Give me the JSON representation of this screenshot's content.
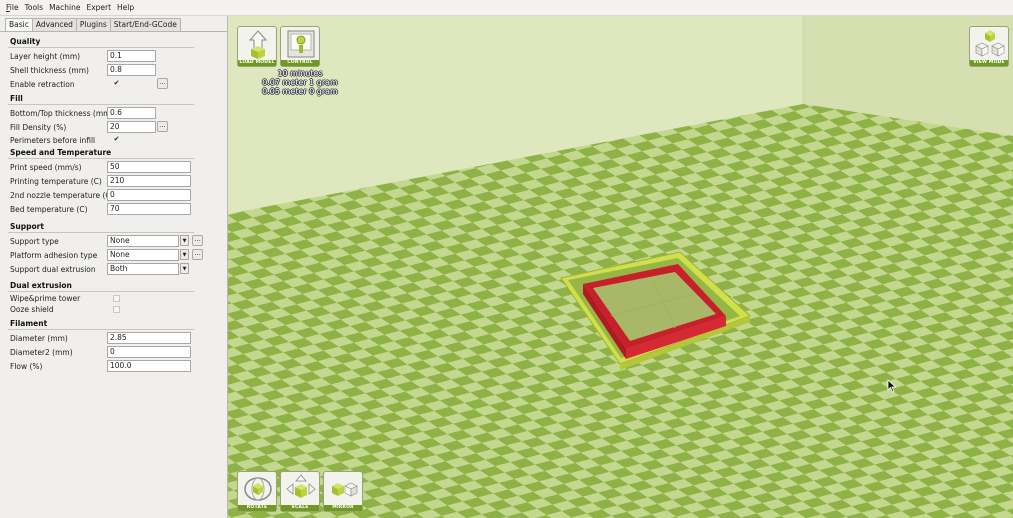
{
  "menu": {
    "items": [
      {
        "underlined": "F",
        "rest": "ile"
      },
      {
        "underlined": "",
        "rest": "Tools"
      },
      {
        "underlined": "",
        "rest": "Machine"
      },
      {
        "underlined": "",
        "rest": "Expert"
      },
      {
        "underlined": "",
        "rest": "Help"
      }
    ]
  },
  "tabs": [
    "Basic",
    "Advanced",
    "Plugins",
    "Start/End-GCode"
  ],
  "sections": {
    "quality": "Quality",
    "fill": "Fill",
    "speed": "Speed and Temperature",
    "support": "Support",
    "dual": "Dual extrusion",
    "filament": "Filament"
  },
  "settings": {
    "layer_height": {
      "label": "Layer height (mm)",
      "value": "0.1"
    },
    "shell_thickness": {
      "label": "Shell thickness (mm)",
      "value": "0.8"
    },
    "enable_retraction": {
      "label": "Enable retraction",
      "checked": "✔"
    },
    "bottom_top_thickness": {
      "label": "Bottom/Top thickness (mm)",
      "value": "0.6"
    },
    "fill_density": {
      "label": "Fill Density (%)",
      "value": "20"
    },
    "perimeters_before_infill": {
      "label": "Perimeters before infill",
      "checked": "✔"
    },
    "print_speed": {
      "label": "Print speed (mm/s)",
      "value": "50"
    },
    "printing_temperature": {
      "label": "Printing temperature (C)",
      "value": "210"
    },
    "nozzle2_temperature": {
      "label": "2nd nozzle temperature (C)",
      "value": "0"
    },
    "bed_temperature": {
      "label": "Bed temperature (C)",
      "value": "70"
    },
    "support_type": {
      "label": "Support type",
      "value": "None"
    },
    "platform_adhesion": {
      "label": "Platform adhesion type",
      "value": "None"
    },
    "support_dual": {
      "label": "Support dual extrusion",
      "value": "Both"
    },
    "wipe_prime": {
      "label": "Wipe&prime tower"
    },
    "ooze_shield": {
      "label": "Ooze shield"
    },
    "diameter": {
      "label": "Diameter (mm)",
      "value": "2.85"
    },
    "diameter2": {
      "label": "Diameter2 (mm)",
      "value": "0"
    },
    "flow": {
      "label": "Flow (%)",
      "value": "100.0"
    }
  },
  "dots_label": "...",
  "combo_arrow": "▼",
  "viewport": {
    "load_model": "LOAD MODEL",
    "control": "CONTROL",
    "view_mode": "VIEW MODE",
    "rotate": "ROTATE",
    "scale": "SCALE",
    "mirror": "MIRROR",
    "print_info": [
      "10 minutes",
      "0.07 meter 1 gram",
      "0.05 meter 0 gram"
    ]
  },
  "colors": {
    "checker_light": "#c4d78f",
    "checker_dark": "#8fb246",
    "wall_back": "#dee7be",
    "wall_left": "#d2ddab",
    "object_red": "#c8202a",
    "object_yellow": "#cfe04c",
    "accent_green": "#6f9a1f"
  },
  "icons": [
    "load-model-icon",
    "control-icon",
    "view-mode-icon",
    "rotate-icon",
    "scale-icon",
    "mirror-icon",
    "mouse-cursor-icon"
  ]
}
